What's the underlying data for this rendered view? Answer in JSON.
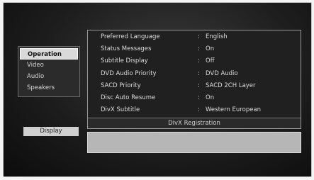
{
  "left_menu": {
    "items": [
      {
        "label": "Operation",
        "active": true
      },
      {
        "label": "Video",
        "active": false
      },
      {
        "label": "Audio",
        "active": false
      },
      {
        "label": "Speakers",
        "active": false
      }
    ]
  },
  "display_tag": "Display",
  "settings": [
    {
      "label": "Preferred Language",
      "value": "English"
    },
    {
      "label": "Status Messages",
      "value": "On"
    },
    {
      "label": "Subtitle Display",
      "value": "Off"
    },
    {
      "label": "DVD Audio Priority",
      "value": "DVD Audio"
    },
    {
      "label": "SACD Priority",
      "value": "SACD 2CH Layer"
    },
    {
      "label": "Disc Auto Resume",
      "value": "On"
    },
    {
      "label": "DivX Subtitle",
      "value": "Western European"
    }
  ],
  "settings_footer": "DivX Registration",
  "colors": {
    "screen_bg": "#1d1d1d",
    "active_item_bg": "#d9d9d9",
    "text": "#dcdcdc"
  }
}
